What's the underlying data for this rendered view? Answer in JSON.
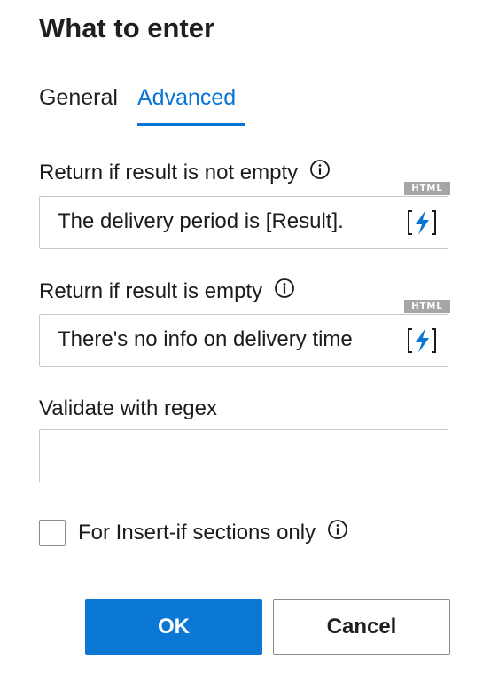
{
  "dialog": {
    "title": "What to enter"
  },
  "tabs": [
    {
      "label": "General",
      "active": false
    },
    {
      "label": "Advanced",
      "active": true
    }
  ],
  "fields": {
    "not_empty": {
      "label": "Return if result is not empty",
      "badge": "HTML",
      "value": "The delivery period is [Result].",
      "insert_icon": "lightning-bracket-icon"
    },
    "empty": {
      "label": "Return if result is empty",
      "badge": "HTML",
      "value": "There's no info on delivery time",
      "insert_icon": "lightning-bracket-icon"
    },
    "regex": {
      "label": "Validate with regex",
      "value": ""
    }
  },
  "checkbox": {
    "label": "For Insert-if sections only",
    "checked": false
  },
  "buttons": {
    "ok": "OK",
    "cancel": "Cancel"
  },
  "colors": {
    "accent": "#0a74d6",
    "badge": "#a6a6a6",
    "border": "#c8c8c8"
  }
}
